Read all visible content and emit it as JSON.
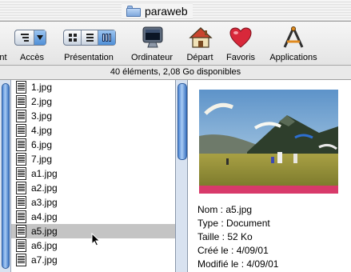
{
  "window": {
    "title": "paraweb"
  },
  "toolbar": {
    "items": [
      {
        "label": "nt"
      },
      {
        "label": "Accès"
      },
      {
        "label": "Présentation"
      },
      {
        "label": "Ordinateur"
      },
      {
        "label": "Départ"
      },
      {
        "label": "Favoris"
      },
      {
        "label": "Applications"
      }
    ]
  },
  "status": {
    "text": "40 éléments, 2,08 Go disponibles"
  },
  "files": [
    {
      "name": "1.jpg"
    },
    {
      "name": "2.jpg"
    },
    {
      "name": "3.jpg"
    },
    {
      "name": "4.jpg"
    },
    {
      "name": "6.jpg"
    },
    {
      "name": "7.jpg"
    },
    {
      "name": "a1.jpg"
    },
    {
      "name": "a2.jpg"
    },
    {
      "name": "a3.jpg"
    },
    {
      "name": "a4.jpg"
    },
    {
      "name": "a5.jpg"
    },
    {
      "name": "a6.jpg"
    },
    {
      "name": "a7.jpg"
    }
  ],
  "selected_file": "a5.jpg",
  "info": {
    "nom_label": "Nom :",
    "nom_value": "a5.jpg",
    "type_label": "Type :",
    "type_value": "Document",
    "taille_label": "Taille :",
    "taille_value": "52 Ko",
    "cree_label": "Créé le :",
    "cree_value": "4/09/01",
    "modifie_label": "Modifié le :",
    "modifie_value": "4/09/01"
  }
}
